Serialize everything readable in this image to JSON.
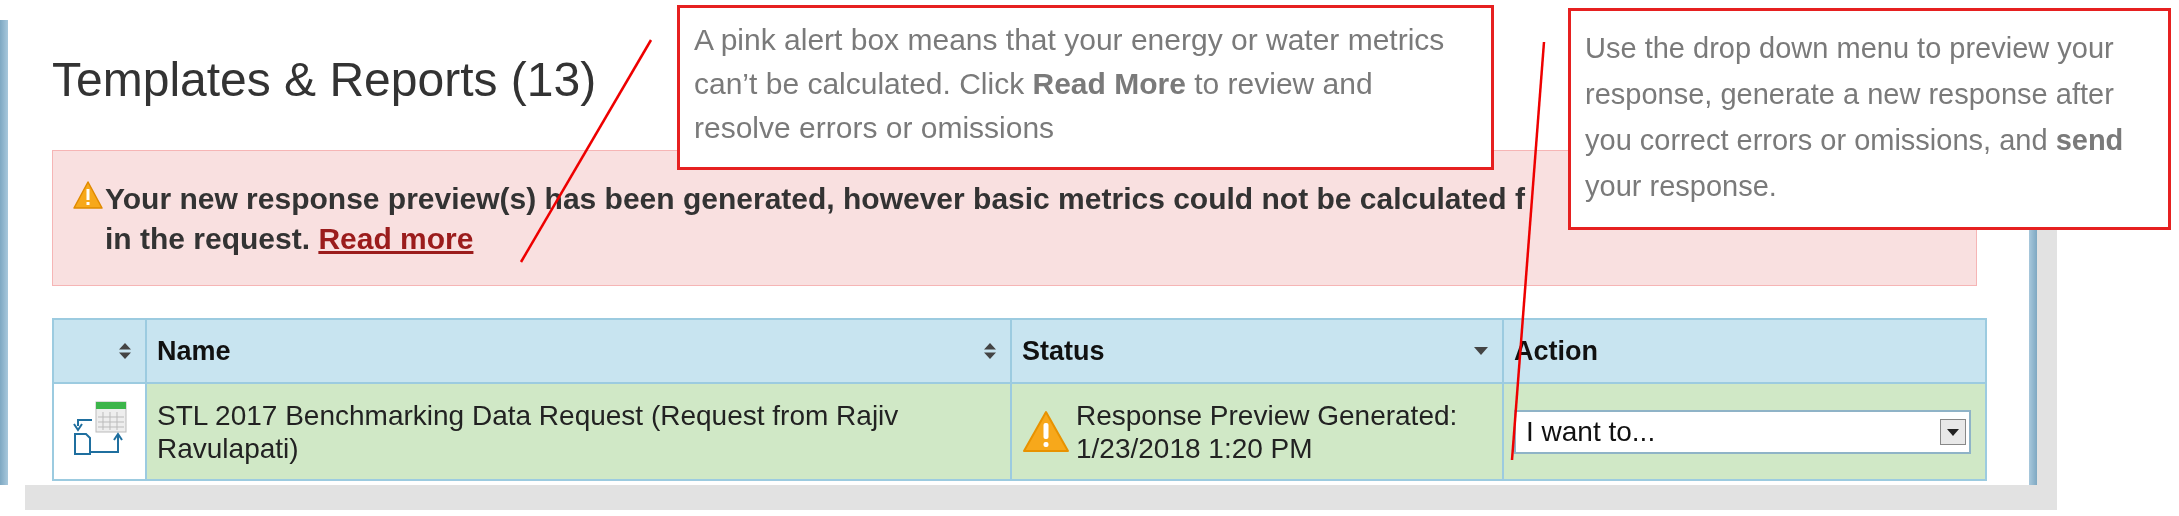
{
  "title": "Templates & Reports (13)",
  "alert": {
    "line1": "Your new response preview(s) has been generated, however basic metrics could not be calculated f",
    "line2": "in the request.",
    "link": "Read more"
  },
  "table": {
    "columns": [
      {
        "kind": "sortable"
      },
      {
        "label": "Name",
        "kind": "sortable"
      },
      {
        "label": "Status",
        "kind": "sorted"
      },
      {
        "label": "Action",
        "kind": "plain"
      }
    ],
    "rows": [
      {
        "name": "STL 2017 Benchmarking Data Request (Request from Rajiv Ravulapati)",
        "status": "Response Preview Generated: 1/23/2018 1:20 PM",
        "warning": true,
        "action": "I want to..."
      }
    ]
  },
  "callouts": [
    {
      "text": "A pink alert box means that your energy or water metrics can’t be calculated. Click **Read More** to review and resolve errors or omissions"
    },
    {
      "text": "Use the drop down menu to preview your response, generate a new response after you correct errors or omissions, and **send** your response."
    }
  ]
}
